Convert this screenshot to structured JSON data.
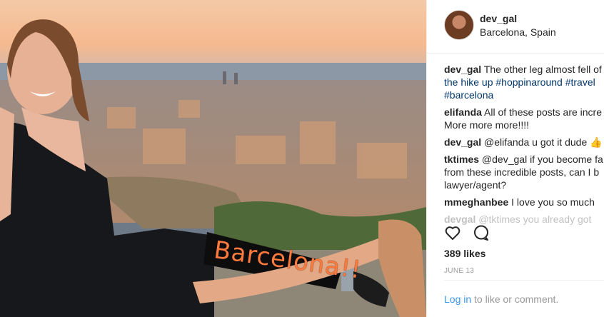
{
  "post": {
    "username": "dev_gal",
    "location": "Barcelona, Spain",
    "photo": {
      "alt": "dev_gal sitting on a wall above Barcelona with a prosthetic leg"
    },
    "leg_text": "Barcelona!!"
  },
  "comments": [
    {
      "user": "dev_gal",
      "lines": [
        "The other leg almost fell of",
        "the hike up #hoppinaround #travel",
        "#barcelona"
      ]
    },
    {
      "user": "elifanda",
      "lines": [
        "All of these posts are incre",
        "More more more!!!!"
      ]
    },
    {
      "user": "dev_gal",
      "lines": [
        "@elifanda u got it dude 👍"
      ]
    },
    {
      "user": "tktimes",
      "lines": [
        "@dev_gal if you become fa",
        "from these incredible posts, can I b",
        "lawyer/agent?"
      ]
    },
    {
      "user": "mmeghanbee",
      "lines": [
        "I love you so much"
      ]
    },
    {
      "user": "devgal",
      "lines": [
        "@tktimes you already got"
      ]
    }
  ],
  "actions": {
    "like_icon": "heart-icon",
    "comment_icon": "comment-icon"
  },
  "likes": "389 likes",
  "date": "JUNE 13",
  "login": {
    "link": "Log in",
    "rest": " to like or comment."
  }
}
